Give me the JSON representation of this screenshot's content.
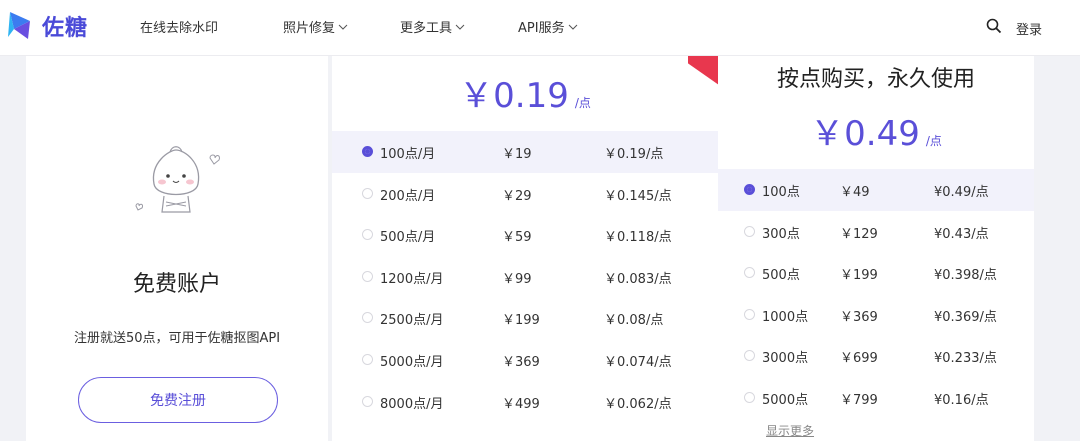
{
  "header": {
    "brand": "佐糖",
    "nav": [
      {
        "label": "在线去除水印",
        "dropdown": false
      },
      {
        "label": "照片修复",
        "dropdown": true
      },
      {
        "label": "更多工具",
        "dropdown": true
      },
      {
        "label": "API服务",
        "dropdown": true
      }
    ],
    "login": "登录"
  },
  "free": {
    "title": "免费账户",
    "desc": "注册就送50点，可用于佐糖抠图API",
    "button": "免费注册"
  },
  "monthly": {
    "price": "￥0.19",
    "unit": "/点",
    "rows": [
      {
        "plan": "100点/月",
        "price": "￥19",
        "unit_price": "￥0.19/点",
        "selected": true
      },
      {
        "plan": "200点/月",
        "price": "￥29",
        "unit_price": "￥0.145/点",
        "selected": false
      },
      {
        "plan": "500点/月",
        "price": "￥59",
        "unit_price": "￥0.118/点",
        "selected": false
      },
      {
        "plan": "1200点/月",
        "price": "￥99",
        "unit_price": "￥0.083/点",
        "selected": false
      },
      {
        "plan": "2500点/月",
        "price": "￥199",
        "unit_price": "￥0.08/点",
        "selected": false
      },
      {
        "plan": "5000点/月",
        "price": "￥369",
        "unit_price": "￥0.074/点",
        "selected": false
      },
      {
        "plan": "8000点/月",
        "price": "￥499",
        "unit_price": "￥0.062/点",
        "selected": false
      }
    ]
  },
  "points": {
    "title": "按点购买，永久使用",
    "price": "￥0.49",
    "unit": "/点",
    "rows": [
      {
        "plan": "100点",
        "price": "￥49",
        "unit_price": "¥0.49/点",
        "selected": true
      },
      {
        "plan": "300点",
        "price": "￥129",
        "unit_price": "¥0.43/点",
        "selected": false
      },
      {
        "plan": "500点",
        "price": "￥199",
        "unit_price": "¥0.398/点",
        "selected": false
      },
      {
        "plan": "1000点",
        "price": "￥369",
        "unit_price": "¥0.369/点",
        "selected": false
      },
      {
        "plan": "3000点",
        "price": "￥699",
        "unit_price": "¥0.233/点",
        "selected": false
      },
      {
        "plan": "5000点",
        "price": "￥799",
        "unit_price": "¥0.16/点",
        "selected": false
      }
    ],
    "show_more": "显示更多"
  },
  "colors": {
    "accent": "#5a4fd8",
    "ribbon": "#e8374e"
  }
}
